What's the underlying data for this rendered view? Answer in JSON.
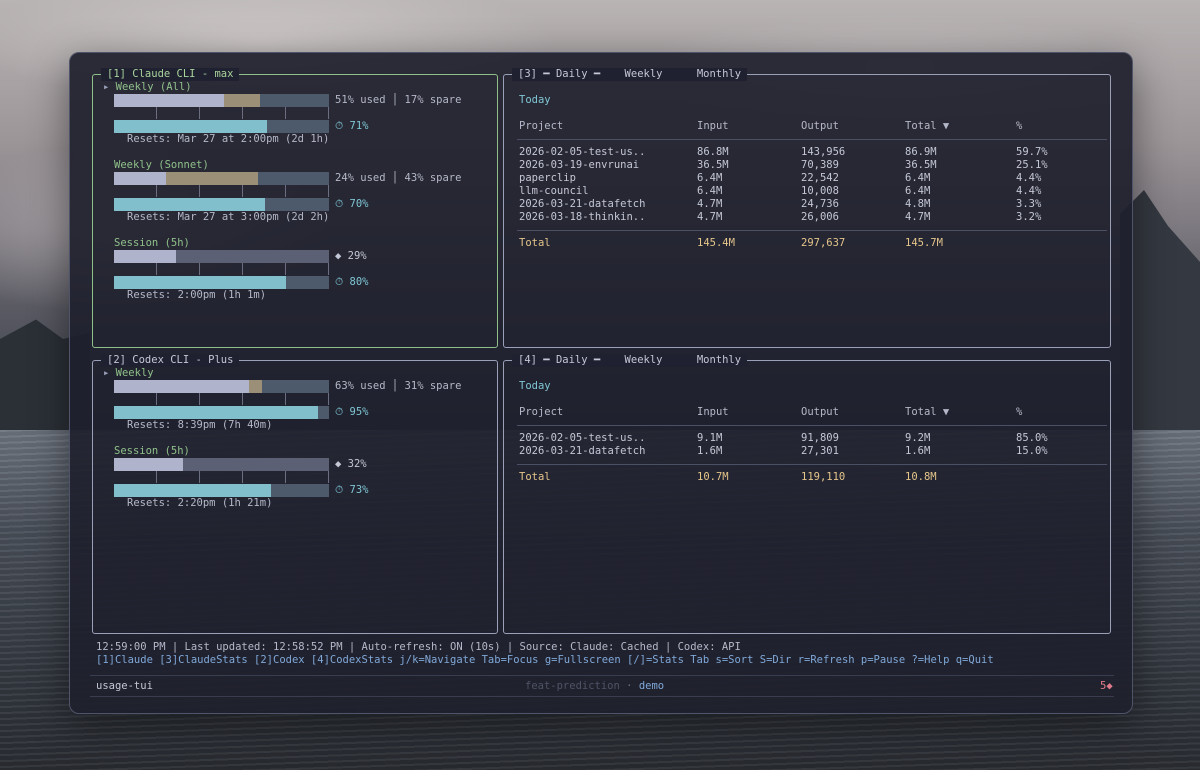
{
  "claude": {
    "title": "[1] Claude CLI - max",
    "weekly_all": {
      "label": "Weekly (All)",
      "used_text": "51% used",
      "spare_text": "17% spare",
      "used_fraction": 0.51,
      "spare_fraction": 0.17,
      "pred_percent": "71%",
      "pred_fraction": 0.71,
      "resets": "Resets: Mar 27 at 2:00pm (2d 1h)"
    },
    "weekly_sonnet": {
      "label": "Weekly (Sonnet)",
      "used_text": "24% used",
      "spare_text": "43% spare",
      "used_fraction": 0.24,
      "spare_fraction": 0.43,
      "pred_percent": "70%",
      "pred_fraction": 0.7,
      "resets": "Resets: Mar 27 at 3:00pm (2d 2h)"
    },
    "session": {
      "label": "Session (5h)",
      "used_text": "29%",
      "used_fraction": 0.29,
      "pred_percent": "80%",
      "pred_fraction": 0.8,
      "resets": "Resets: 2:00pm (1h 1m)"
    }
  },
  "codex": {
    "title": "[2] Codex CLI - Plus",
    "weekly": {
      "label": "Weekly",
      "used_text": "63% used",
      "spare_text": "31% spare",
      "used_fraction": 0.63,
      "spare_fraction": 0.06,
      "pred_percent": "95%",
      "pred_fraction": 0.95,
      "resets": "Resets: 8:39pm (7h 40m)"
    },
    "session": {
      "label": "Session (5h)",
      "used_text": "32%",
      "used_fraction": 0.32,
      "pred_percent": "73%",
      "pred_fraction": 0.73,
      "resets": "Resets: 2:20pm (1h 21m)"
    }
  },
  "stats3": {
    "prefix": "[3]",
    "tabs": [
      "Daily",
      "Weekly",
      "Monthly"
    ],
    "period": "Today",
    "headers": [
      "Project",
      "Input",
      "Output",
      "Total ▼",
      "%"
    ],
    "rows": [
      [
        "2026-02-05-test-us..",
        "86.8M",
        "143,956",
        "86.9M",
        "59.7%"
      ],
      [
        "2026-03-19-envrunai",
        "36.5M",
        "70,389",
        "36.5M",
        "25.1%"
      ],
      [
        "paperclip",
        "6.4M",
        "22,542",
        "6.4M",
        "4.4%"
      ],
      [
        "llm-council",
        "6.4M",
        "10,008",
        "6.4M",
        "4.4%"
      ],
      [
        "2026-03-21-datafetch",
        "4.7M",
        "24,736",
        "4.8M",
        "3.3%"
      ],
      [
        "2026-03-18-thinkin..",
        "4.7M",
        "26,006",
        "4.7M",
        "3.2%"
      ]
    ],
    "total": [
      "Total",
      "145.4M",
      "297,637",
      "145.7M"
    ]
  },
  "stats4": {
    "prefix": "[4]",
    "tabs": [
      "Daily",
      "Weekly",
      "Monthly"
    ],
    "period": "Today",
    "headers": [
      "Project",
      "Input",
      "Output",
      "Total ▼",
      "%"
    ],
    "rows": [
      [
        "2026-02-05-test-us..",
        "9.1M",
        "91,809",
        "9.2M",
        "85.0%"
      ],
      [
        "2026-03-21-datafetch",
        "1.6M",
        "27,301",
        "1.6M",
        "15.0%"
      ]
    ],
    "total": [
      "Total",
      "10.7M",
      "119,110",
      "10.8M"
    ]
  },
  "status": {
    "line": "12:59:00 PM | Last updated: 12:58:52 PM | Auto-refresh: ON (10s) | Source: Claude: Cached | Codex: API",
    "keys": "[1]Claude  [3]ClaudeStats  [2]Codex  [4]CodexStats  j/k=Navigate  Tab=Focus  g=Fullscreen  [/]=Stats Tab  s=Sort  S=Dir  r=Refresh  p=Pause  ?=Help  q=Quit"
  },
  "tmux": {
    "session": "usage-tui",
    "branch": "feat-prediction",
    "separator": "·",
    "window": "demo",
    "indicator": "5◆"
  },
  "icons": {
    "clock": "⏱",
    "diamond": "◆",
    "arrow": "▸"
  },
  "colors": {
    "used": "#b0b3cc",
    "spare": "#9b8f78",
    "prediction": "#80bfcb",
    "track": "#4d5a6c",
    "session_track": "#5b6075",
    "active_border": "#8fc08a",
    "accent_cyan": "#7fc6d4",
    "total_gold": "#e4c58a"
  }
}
